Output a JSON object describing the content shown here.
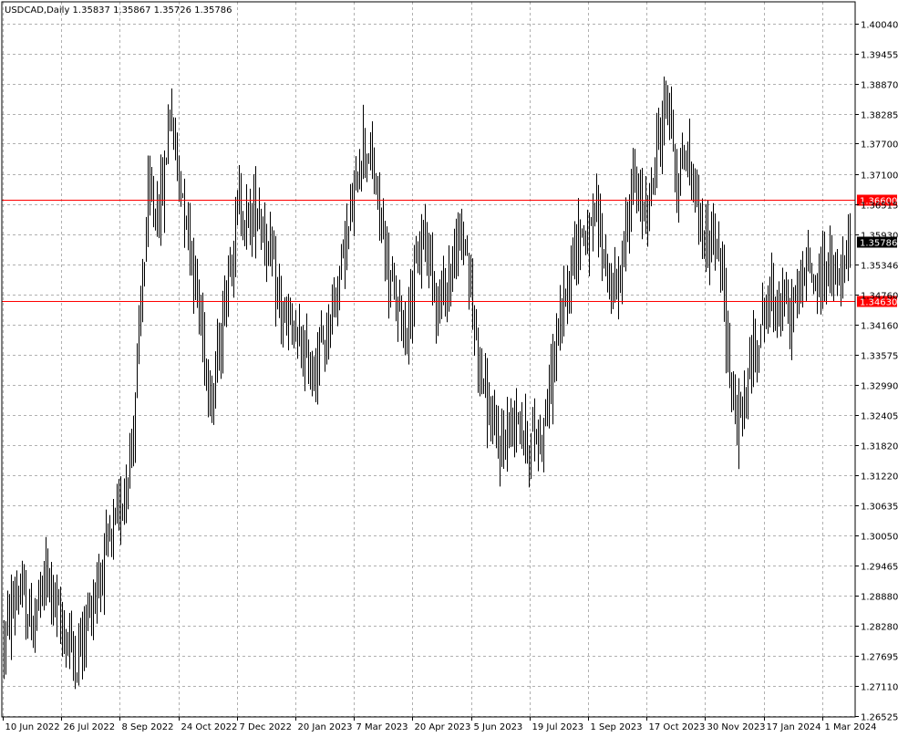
{
  "chart_data": {
    "type": "ohlc",
    "title": "USDCAD,Daily  1.35837 1.35867 1.35726 1.35786",
    "symbol": "USDCAD",
    "timeframe": "Daily",
    "last_ohlc": {
      "open": 1.35837,
      "high": 1.35867,
      "low": 1.35726,
      "close": 1.35786
    },
    "ylim": [
      1.26525,
      1.4033
    ],
    "y_ticks": [
      "1.40040",
      "1.39455",
      "1.38870",
      "1.38285",
      "1.37700",
      "1.37100",
      "1.36515",
      "1.35930",
      "1.35346",
      "1.34760",
      "1.34160",
      "1.33575",
      "1.32990",
      "1.32405",
      "1.31820",
      "1.31220",
      "1.30635",
      "1.30050",
      "1.29465",
      "1.28880",
      "1.28280",
      "1.27695",
      "1.27110",
      "1.26525"
    ],
    "x_ticks": [
      "10 Jun 2022",
      "26 Jul 2022",
      "8 Sep 2022",
      "24 Oct 2022",
      "7 Dec 2022",
      "20 Jan 2023",
      "7 Mar 2023",
      "20 Apr 2023",
      "5 Jun 2023",
      "19 Jul 2023",
      "1 Sep 2023",
      "17 Oct 2023",
      "30 Nov 2023",
      "17 Jan 2024",
      "1 Mar 2024"
    ],
    "horizontal_lines": [
      {
        "price": 1.366,
        "label": "1.36600",
        "color": "#ff0000"
      },
      {
        "price": 1.3463,
        "label": "1.34630",
        "color": "#ff0000"
      }
    ],
    "current_price": {
      "price": 1.35786,
      "label": "1.35786"
    },
    "grid": true,
    "series_waypoints": [
      [
        0,
        1.28
      ],
      [
        15,
        1.29
      ],
      [
        30,
        1.283
      ],
      [
        48,
        1.293
      ],
      [
        60,
        1.284
      ],
      [
        80,
        1.276
      ],
      [
        95,
        1.287
      ],
      [
        110,
        1.296
      ],
      [
        125,
        1.303
      ],
      [
        140,
        1.318
      ],
      [
        150,
        1.345
      ],
      [
        158,
        1.366
      ],
      [
        168,
        1.364
      ],
      [
        175,
        1.368
      ],
      [
        182,
        1.385
      ],
      [
        190,
        1.372
      ],
      [
        200,
        1.364
      ],
      [
        210,
        1.35
      ],
      [
        220,
        1.337
      ],
      [
        228,
        1.327
      ],
      [
        238,
        1.34
      ],
      [
        248,
        1.355
      ],
      [
        258,
        1.365
      ],
      [
        268,
        1.362
      ],
      [
        278,
        1.365
      ],
      [
        288,
        1.358
      ],
      [
        298,
        1.349
      ],
      [
        308,
        1.342
      ],
      [
        318,
        1.339
      ],
      [
        328,
        1.336
      ],
      [
        338,
        1.333
      ],
      [
        348,
        1.337
      ],
      [
        358,
        1.343
      ],
      [
        368,
        1.352
      ],
      [
        378,
        1.36
      ],
      [
        385,
        1.367
      ],
      [
        393,
        1.378
      ],
      [
        400,
        1.375
      ],
      [
        410,
        1.366
      ],
      [
        420,
        1.353
      ],
      [
        430,
        1.345
      ],
      [
        440,
        1.341
      ],
      [
        450,
        1.35
      ],
      [
        460,
        1.36
      ],
      [
        468,
        1.355
      ],
      [
        476,
        1.345
      ],
      [
        486,
        1.35
      ],
      [
        496,
        1.356
      ],
      [
        506,
        1.359
      ],
      [
        513,
        1.345
      ],
      [
        523,
        1.333
      ],
      [
        533,
        1.323
      ],
      [
        543,
        1.317
      ],
      [
        553,
        1.321
      ],
      [
        563,
        1.326
      ],
      [
        573,
        1.318
      ],
      [
        583,
        1.32
      ],
      [
        593,
        1.322
      ],
      [
        603,
        1.335
      ],
      [
        613,
        1.345
      ],
      [
        623,
        1.355
      ],
      [
        633,
        1.36
      ],
      [
        643,
        1.358
      ],
      [
        650,
        1.364
      ],
      [
        658,
        1.355
      ],
      [
        668,
        1.347
      ],
      [
        678,
        1.353
      ],
      [
        688,
        1.37
      ],
      [
        698,
        1.364
      ],
      [
        708,
        1.366
      ],
      [
        718,
        1.378
      ],
      [
        728,
        1.387
      ],
      [
        738,
        1.37
      ],
      [
        748,
        1.375
      ],
      [
        758,
        1.368
      ],
      [
        768,
        1.358
      ],
      [
        778,
        1.358
      ],
      [
        788,
        1.35
      ],
      [
        796,
        1.334
      ],
      [
        804,
        1.322
      ],
      [
        812,
        1.326
      ],
      [
        822,
        1.336
      ],
      [
        832,
        1.344
      ],
      [
        842,
        1.347
      ],
      [
        852,
        1.346
      ],
      [
        862,
        1.343
      ],
      [
        872,
        1.349
      ],
      [
        882,
        1.353
      ],
      [
        892,
        1.35
      ],
      [
        902,
        1.354
      ],
      [
        912,
        1.349
      ],
      [
        922,
        1.352
      ],
      [
        932,
        1.3579
      ]
    ]
  }
}
